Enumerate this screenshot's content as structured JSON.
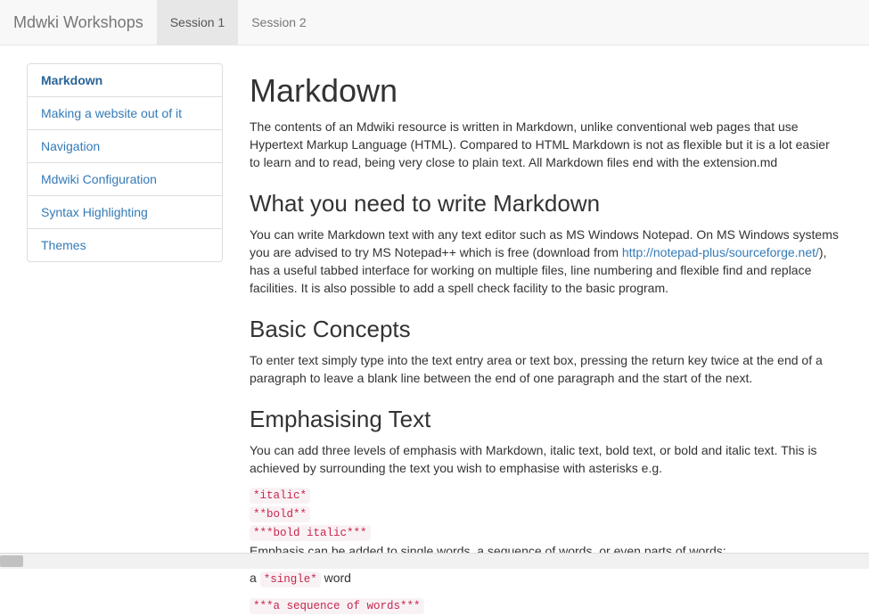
{
  "navbar": {
    "brand": "Mdwki Workshops",
    "tabs": [
      {
        "label": "Session 1",
        "active": true
      },
      {
        "label": "Session 2",
        "active": false
      }
    ]
  },
  "sidebar": {
    "items": [
      {
        "label": "Markdown",
        "active": true
      },
      {
        "label": "Making a website out of it",
        "active": false
      },
      {
        "label": "Navigation",
        "active": false
      },
      {
        "label": "Mdwiki Configuration",
        "active": false
      },
      {
        "label": "Syntax Highlighting",
        "active": false
      },
      {
        "label": "Themes",
        "active": false
      }
    ]
  },
  "content": {
    "h1": "Markdown",
    "intro": "The contents of an Mdwiki resource is written in Markdown, unlike conventional web pages that use Hypertext Markup Language (HTML). Compared to HTML Markdown is not as flexible but it is a lot easier to learn and to read, being very close to plain text. All Markdown files end with the extension.md",
    "h2a": "What you need to write Markdown",
    "need_pre": "You can write Markdown text with any text editor such as MS Windows Notepad. On MS Windows systems you are advised to try MS Notepad++ which is free (download from ",
    "need_link": "http://notepad-plus/sourceforge.net/",
    "need_post": "), has a useful tabbed interface for working on multiple files, line numbering and flexible find and replace facilities. It is also possible to add a spell check facility to the basic program.",
    "h2b": "Basic Concepts",
    "basic": "To enter text simply type into the text entry area or text box, pressing the return key twice at the end of a paragraph to leave a blank line between the end of one paragraph and the start of the next.",
    "h2c": "Emphasising Text",
    "emph_intro": "You can add three levels of emphasis with Markdown, italic text, bold text, or bold and italic text. This is achieved by surrounding the text you wish to emphasise with asterisks e.g.",
    "code_italic": "*italic*",
    "code_bold": "**bold**",
    "code_bold_italic": "***bold italic***",
    "emph_mid": "Emphasis can be added to single words, a sequence of words, or even parts of words:",
    "emph_a_pre": "a ",
    "code_single": "*single*",
    "emph_a_post": " word",
    "code_seq": "***a sequence of words***"
  }
}
